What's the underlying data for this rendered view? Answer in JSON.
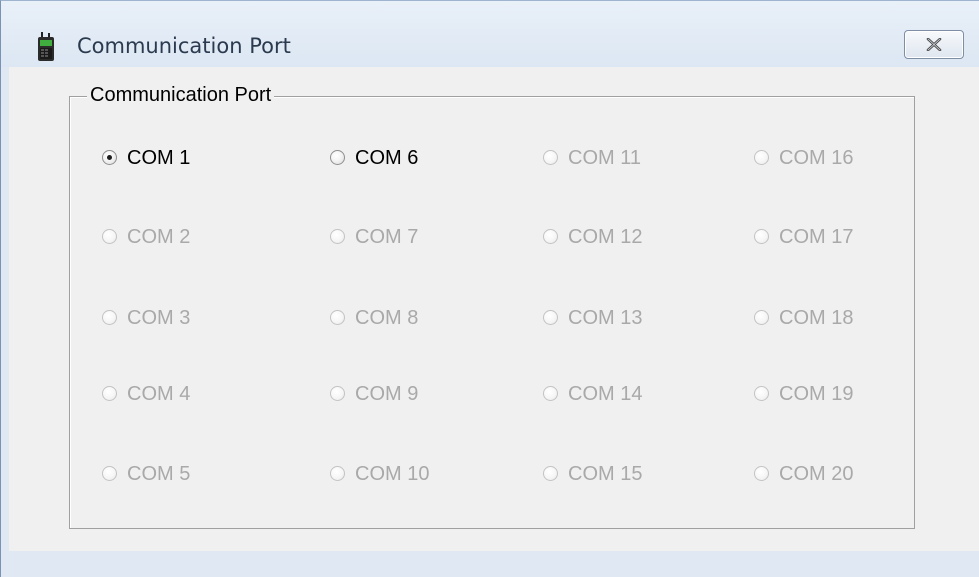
{
  "window": {
    "title": "Communication Port"
  },
  "group": {
    "label": "Communication Port"
  },
  "ports": [
    {
      "label": "COM 1",
      "checked": true,
      "enabled": true
    },
    {
      "label": "COM 2",
      "checked": false,
      "enabled": false
    },
    {
      "label": "COM 3",
      "checked": false,
      "enabled": false
    },
    {
      "label": "COM 4",
      "checked": false,
      "enabled": false
    },
    {
      "label": "COM 5",
      "checked": false,
      "enabled": false
    },
    {
      "label": "COM 6",
      "checked": false,
      "enabled": true
    },
    {
      "label": "COM 7",
      "checked": false,
      "enabled": false
    },
    {
      "label": "COM 8",
      "checked": false,
      "enabled": false
    },
    {
      "label": "COM 9",
      "checked": false,
      "enabled": false
    },
    {
      "label": "COM 10",
      "checked": false,
      "enabled": false
    },
    {
      "label": "COM 11",
      "checked": false,
      "enabled": false
    },
    {
      "label": "COM 12",
      "checked": false,
      "enabled": false
    },
    {
      "label": "COM 13",
      "checked": false,
      "enabled": false
    },
    {
      "label": "COM 14",
      "checked": false,
      "enabled": false
    },
    {
      "label": "COM 15",
      "checked": false,
      "enabled": false
    },
    {
      "label": "COM 16",
      "checked": false,
      "enabled": false
    },
    {
      "label": "COM 17",
      "checked": false,
      "enabled": false
    },
    {
      "label": "COM 18",
      "checked": false,
      "enabled": false
    },
    {
      "label": "COM 19",
      "checked": false,
      "enabled": false
    },
    {
      "label": "COM 20",
      "checked": false,
      "enabled": false
    }
  ],
  "icons": {
    "app": "radio-handset-icon",
    "close": "close-icon"
  }
}
